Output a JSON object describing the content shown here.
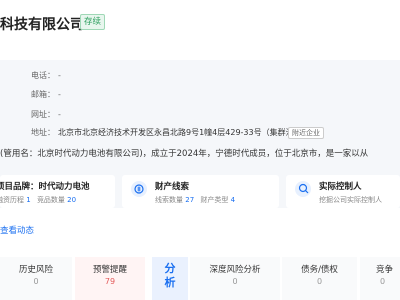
{
  "header": {
    "company_name": "科技有限公司",
    "status_badge": "存续"
  },
  "contact": {
    "phone_label": "电话：",
    "phone_value": "-",
    "email_label": "邮箱：",
    "email_value": "-",
    "website_label": "网址：",
    "website_value": "-",
    "address_label": "地址：",
    "address_value": "北京市北京经济技术开发区永昌北路9号1幢4层429-33号（集群注册）",
    "nearby_button": "附近企业"
  },
  "intro_text": "(管用名：北京时代动力电池有限公司)，成立于2024年，宁德时代成员，位于北京市，是一家以从",
  "cards": [
    {
      "title": "项目品牌：时代动力电池",
      "sub1_label": "融资历程",
      "sub1_value": "1",
      "sub2_label": "竞品数量",
      "sub2_value": "20",
      "icon": "brand-icon"
    },
    {
      "title": "财产线索",
      "sub1_label": "线索数量",
      "sub1_value": "27",
      "sub2_label": "财产类型",
      "sub2_value": "4",
      "icon": "wealth-icon"
    },
    {
      "title": "实际控制人",
      "sub1_label": "挖掘公司实际控制人",
      "sub1_value": "",
      "sub2_label": "",
      "sub2_value": "",
      "icon": "controller-icon"
    }
  ],
  "dynamics_link": "查看动态",
  "risk": {
    "history_label": "历史风险",
    "history_count": "0",
    "warning_label": "预警提醒",
    "warning_count": "79",
    "analyze_label": "分析",
    "deep_risk_label": "深度风险分析",
    "deep_risk_count": "0",
    "debt_label": "债务/债权",
    "debt_count": "0",
    "competitor_label": "竞争",
    "competitor_count": "0"
  },
  "colors": {
    "accent": "#1a6ff0",
    "status_green": "#2a9d5c",
    "warning_red": "#e45b5b",
    "panel_bg": "#f5f7fa"
  }
}
